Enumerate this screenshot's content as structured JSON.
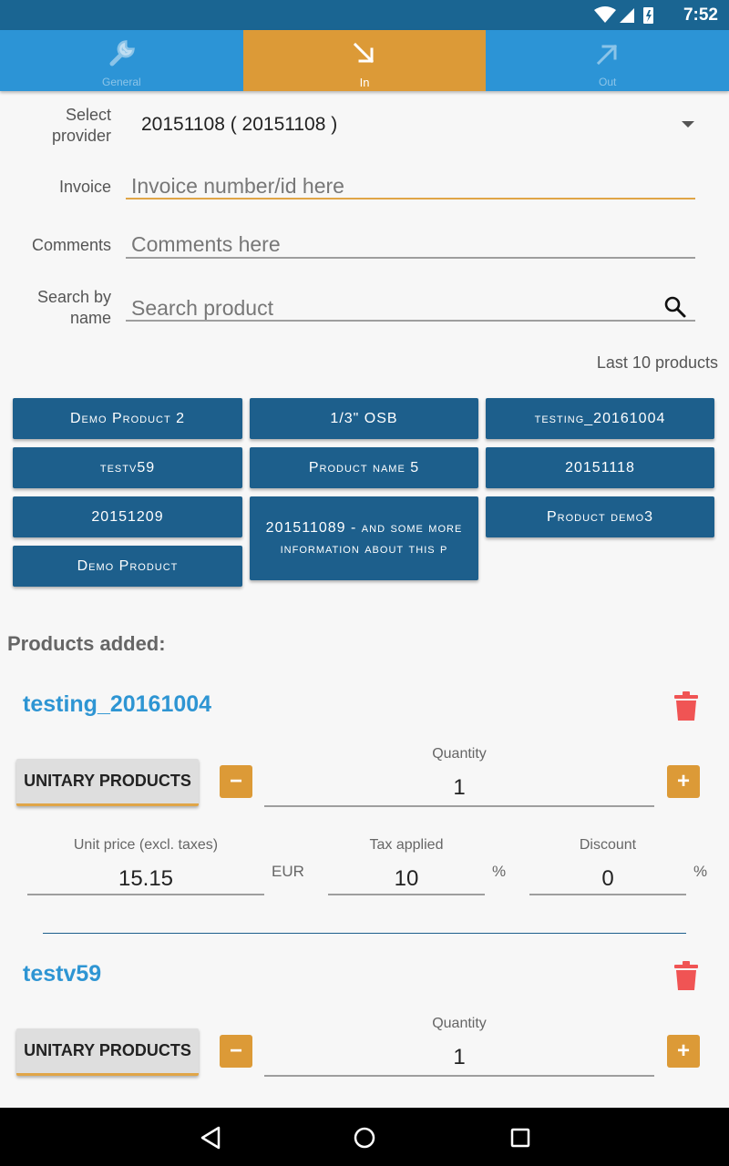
{
  "status": {
    "time": "7:52"
  },
  "tabs": [
    {
      "label": "General",
      "icon": "wrench-icon"
    },
    {
      "label": "In",
      "icon": "arrow-down-right-icon"
    },
    {
      "label": "Out",
      "icon": "arrow-up-right-icon"
    }
  ],
  "form": {
    "provider_label": "Select provider",
    "provider_value": "20151108 ( 20151108 )",
    "invoice_label": "Invoice",
    "invoice_placeholder": "Invoice number/id here",
    "comments_label": "Comments",
    "comments_placeholder": "Comments here",
    "search_label": "Search by name",
    "search_placeholder": "Search product"
  },
  "last_products_label": "Last 10 products",
  "last_products": [
    "Demo Product 2",
    "1/3\" OSB",
    "testing_20161004",
    "testv59",
    "Product name 5",
    "20151118",
    "20151209",
    "201511089 - and some more information about this p",
    "Product demo3",
    "Demo Product"
  ],
  "products_added_title": "Products added:",
  "products_added": [
    {
      "name": "testing_20161004",
      "type_label": "UNITARY PRODUCTS",
      "quantity_label": "Quantity",
      "quantity": "1",
      "unit_price_label": "Unit price (excl. taxes)",
      "unit_price": "15.15",
      "currency": "EUR",
      "tax_label": "Tax applied",
      "tax": "10",
      "tax_unit": "%",
      "discount_label": "Discount",
      "discount": "0",
      "discount_unit": "%"
    },
    {
      "name": "testv59",
      "type_label": "UNITARY PRODUCTS",
      "quantity_label": "Quantity",
      "quantity": "1"
    }
  ],
  "stepper": {
    "minus": "−",
    "plus": "+"
  },
  "colors": {
    "statusbar": "#1a6592",
    "tabs": "#2c94d6",
    "accent": "#dc9a37",
    "chip": "#1d5f8c",
    "product_name": "#2e95d3",
    "trash": "#f05454"
  }
}
